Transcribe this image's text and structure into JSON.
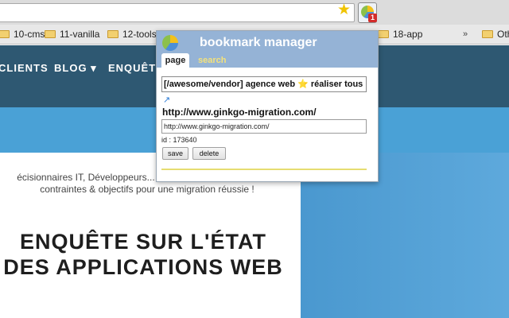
{
  "browser": {
    "bookmarks": [
      {
        "label": "10-cms"
      },
      {
        "label": "11-vanilla"
      },
      {
        "label": "12-tools"
      },
      {
        "label": "18-app"
      },
      {
        "label": "Other"
      }
    ],
    "overflow": "»",
    "extension_badge": "1"
  },
  "site": {
    "nav": [
      "CLIENTS",
      "BLOG ▾",
      "ENQUÊTE"
    ],
    "intro_line1": "écisionnaires IT, Développeurs... Parlez-nous de vos besoins,",
    "intro_line2": "contraintes & objectifs pour une migration réussie !",
    "headline_line1": "ENQUÊTE SUR L'ÉTAT",
    "headline_line2": "DES APPLICATIONS WEB"
  },
  "popup": {
    "title": "bookmark manager",
    "tabs": {
      "page": "page",
      "search": "search"
    },
    "page_title_value": "[/awesome/vendor] agence web ⭐ réaliser tous",
    "url_display": "http://www.ginkgo-migration.com/",
    "url_value": "http://www.ginkgo-migration.com/",
    "id_label": "id : 173640",
    "save_label": "save",
    "delete_label": "delete"
  },
  "colors": {
    "popup_header": "#95b3d6",
    "site_nav": "#2e5872",
    "hero": "#4aa1d6",
    "search_tab": "#f4e27a"
  }
}
